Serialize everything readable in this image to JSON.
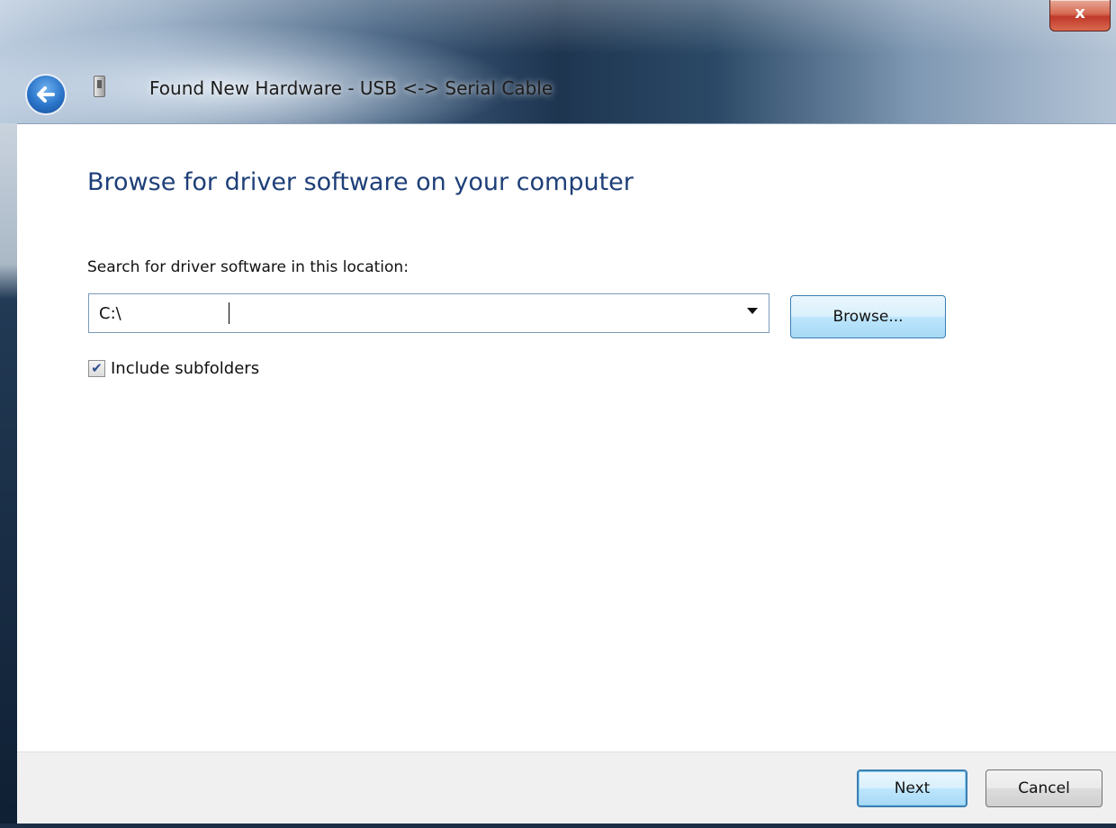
{
  "window": {
    "title": "Found New Hardware - USB <-> Serial Cable",
    "close_label": "x"
  },
  "main": {
    "heading": "Browse for driver software on your computer",
    "search_label": "Search for driver software in this location:",
    "path_value": "C:\\",
    "browse_label": "Browse...",
    "include_subfolders_label": "Include subfolders",
    "include_subfolders_checked": true
  },
  "footer": {
    "next_label": "Next",
    "cancel_label": "Cancel"
  },
  "colors": {
    "heading": "#1e3f78",
    "close_button": "#c0392b",
    "accent_button_border": "#3c7fb1"
  },
  "icons": [
    "back-arrow-icon",
    "usb-device-icon",
    "close-icon",
    "dropdown-arrow-icon",
    "checkmark-icon"
  ]
}
